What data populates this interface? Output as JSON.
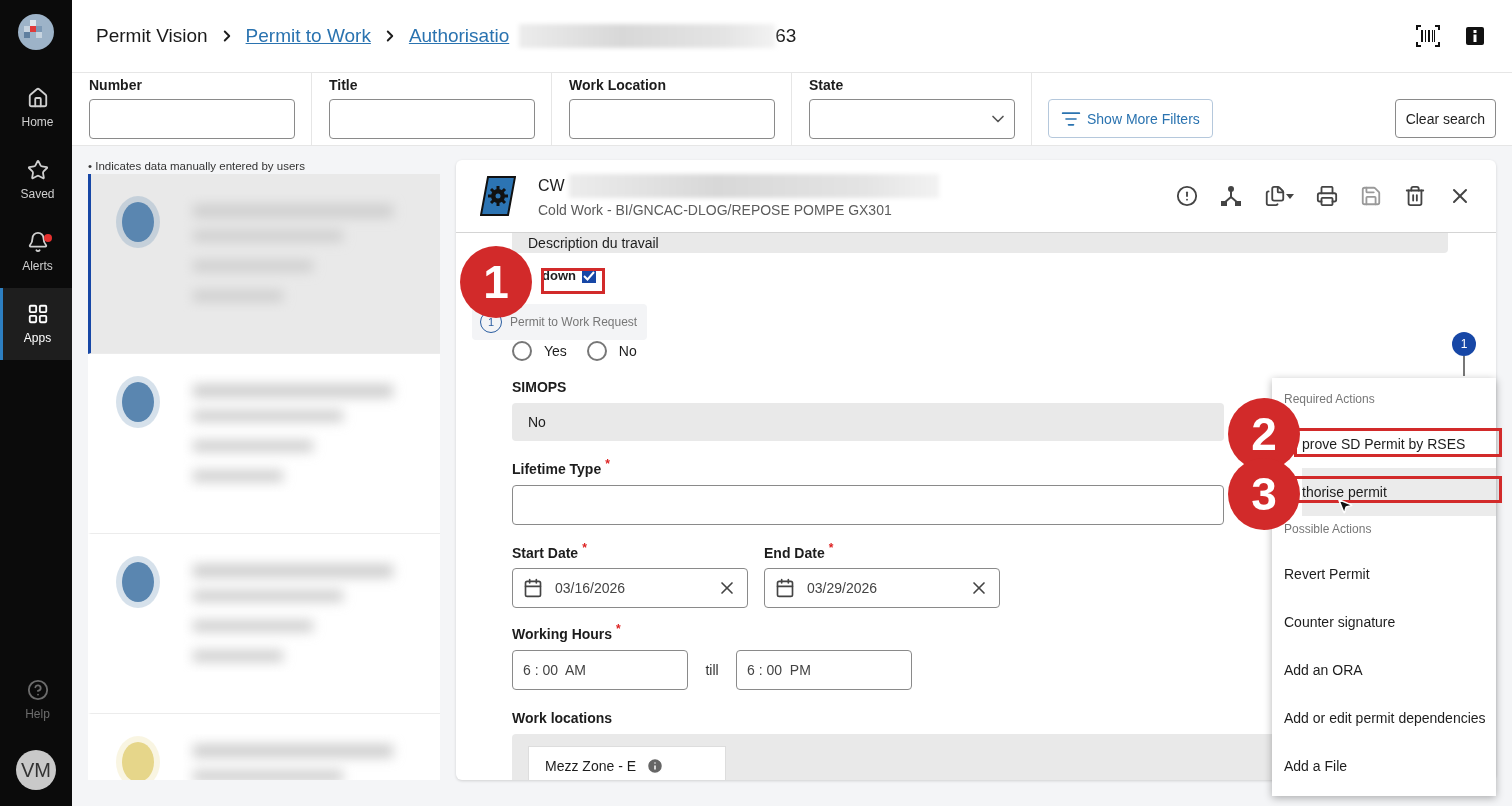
{
  "nav": {
    "items": [
      {
        "label": "Home",
        "selected": false,
        "badge": false
      },
      {
        "label": "Saved",
        "selected": false,
        "badge": false
      },
      {
        "label": "Alerts",
        "selected": false,
        "badge": true
      },
      {
        "label": "Apps",
        "selected": true,
        "badge": false
      }
    ],
    "help": {
      "label": "Help",
      "disabled": true
    },
    "avatar": "VM"
  },
  "breadcrumb": [
    {
      "label": "Permit Vision",
      "kind": "text"
    },
    {
      "label": "Permit to Work",
      "kind": "link"
    },
    {
      "label": "Authorisatio",
      "kind": "link"
    }
  ],
  "breadcrumb_tail": "63",
  "filters": [
    {
      "label": "Number",
      "kind": "text"
    },
    {
      "label": "Title",
      "kind": "text"
    },
    {
      "label": "Work Location",
      "kind": "text"
    },
    {
      "label": "State",
      "kind": "select"
    }
  ],
  "show_more_filters": "Show More Filters",
  "clear_search": "Clear search",
  "list": {
    "note": "• Indicates data manually entered by users",
    "cards": [
      {
        "selected": true,
        "color": "#5a86b0"
      },
      {
        "selected": false,
        "color": "#5a86b0"
      },
      {
        "selected": false,
        "color": "#5a86b0"
      },
      {
        "selected": false,
        "color": "#e6d68a"
      }
    ]
  },
  "record": {
    "title": "CW",
    "subtitle": "Cold Work - BI/GNCAC-DLOG/REPOSE POMPE GX301",
    "toolbar": [
      {
        "disabled": false
      },
      {
        "disabled": false
      },
      {
        "disabled": false
      },
      {
        "disabled": false
      },
      {
        "disabled": true
      },
      {
        "disabled": false
      },
      {
        "disabled": false
      }
    ]
  },
  "form": {
    "description": "Description du travail",
    "checkbox": {
      "label": "down",
      "checked": true
    },
    "step_chip": {
      "number": "1",
      "label": "Permit to Work Request"
    },
    "radios": [
      {
        "label": "Yes",
        "selected": false
      },
      {
        "label": "No",
        "selected": false
      }
    ],
    "simops": {
      "label": "SIMOPS",
      "value": "No"
    },
    "lifetime": {
      "label": "Lifetime Type",
      "required_mark": "*"
    },
    "start_date": {
      "label": "Start Date",
      "required_mark": "*",
      "value": "03/16/2026"
    },
    "end_date": {
      "label": "End Date",
      "required_mark": "*",
      "value": "03/29/2026"
    },
    "working_hours": {
      "label": "Working Hours",
      "required_mark": "*",
      "from": "6 : 00  AM",
      "till": "till",
      "to": "6 : 00  PM"
    },
    "work_locations": {
      "label": "Work locations",
      "items": [
        {
          "name": "Mezz Zone - E"
        }
      ]
    }
  },
  "step_marker": "1",
  "actions_menu": [
    {
      "title": "Required Actions",
      "items": [
        {
          "label": "prove SD Permit by RSES",
          "highlighted": false
        },
        {
          "label": "thorise permit",
          "highlighted": true
        }
      ]
    },
    {
      "title": "Possible Actions",
      "items": [
        {
          "label": "Revert Permit",
          "highlighted": false
        },
        {
          "label": "Counter signature",
          "highlighted": false
        },
        {
          "label": "Add an ORA",
          "highlighted": false
        },
        {
          "label": "Add or edit permit dependencies",
          "highlighted": false
        },
        {
          "label": "Add a File",
          "highlighted": false
        }
      ]
    }
  ],
  "annotations": [
    {
      "number": "1"
    },
    {
      "number": "2"
    },
    {
      "number": "3"
    }
  ]
}
